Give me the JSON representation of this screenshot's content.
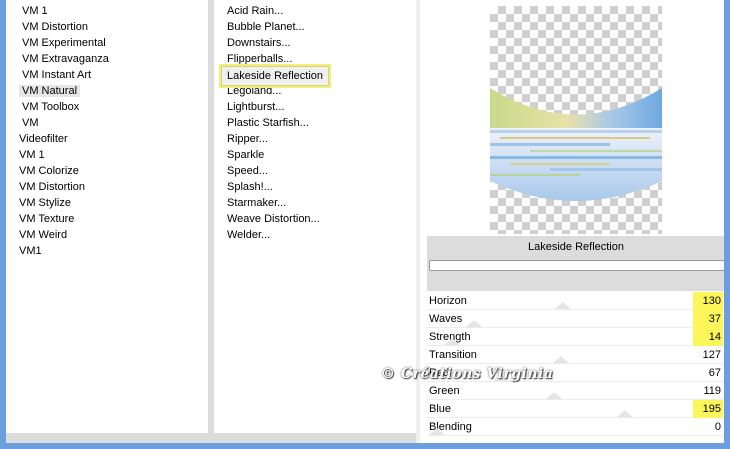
{
  "categories": {
    "items": [
      {
        "label": "VM 1",
        "indent": true
      },
      {
        "label": "VM Distortion",
        "indent": true
      },
      {
        "label": "VM Experimental",
        "indent": true
      },
      {
        "label": "VM Extravaganza",
        "indent": true
      },
      {
        "label": "VM Instant Art",
        "indent": true
      },
      {
        "label": "VM Natural",
        "indent": true,
        "selected": true
      },
      {
        "label": "VM Toolbox",
        "indent": true
      },
      {
        "label": "VM",
        "indent": true
      },
      {
        "label": "Videofilter",
        "indent": false
      },
      {
        "label": "VM 1",
        "indent": false
      },
      {
        "label": "VM Colorize",
        "indent": false
      },
      {
        "label": "VM Distortion",
        "indent": false
      },
      {
        "label": "VM Stylize",
        "indent": false
      },
      {
        "label": "VM Texture",
        "indent": false
      },
      {
        "label": "VM Weird",
        "indent": false
      },
      {
        "label": "VM1",
        "indent": false
      }
    ]
  },
  "filters": {
    "items": [
      {
        "label": "Acid Rain..."
      },
      {
        "label": "Bubble Planet..."
      },
      {
        "label": "Downstairs..."
      },
      {
        "label": "Flipperballs..."
      },
      {
        "label": "Lakeside Reflection",
        "selected": true
      },
      {
        "label": "Legoland..."
      },
      {
        "label": "Lightburst..."
      },
      {
        "label": "Plastic Starfish..."
      },
      {
        "label": "Ripper..."
      },
      {
        "label": "Sparkle"
      },
      {
        "label": "Speed..."
      },
      {
        "label": "Splash!..."
      },
      {
        "label": "Starmaker..."
      },
      {
        "label": "Weave Distortion..."
      },
      {
        "label": "Welder..."
      }
    ]
  },
  "preview": {
    "title": "Lakeside Reflection",
    "progress": 0
  },
  "params": [
    {
      "label": "Horizon",
      "value": "130",
      "highlight": true,
      "fraction": 0.51
    },
    {
      "label": "Waves",
      "value": "37",
      "highlight": true,
      "fraction": 0.15
    },
    {
      "label": "Strength",
      "value": "14",
      "highlight": true,
      "fraction": 0.06
    },
    {
      "label": "Transition",
      "value": "127",
      "highlight": false,
      "fraction": 0.5
    },
    {
      "label": "Red",
      "value": "67",
      "highlight": false,
      "fraction": 0.26
    },
    {
      "label": "Green",
      "value": "119",
      "highlight": false,
      "fraction": 0.47
    },
    {
      "label": "Blue",
      "value": "195",
      "highlight": true,
      "fraction": 0.76
    },
    {
      "label": "Blending",
      "value": "0",
      "highlight": false,
      "fraction": 0.0
    }
  ],
  "watermark": "© Créations Virginia",
  "colors": {
    "background": "#6a9edd",
    "highlight": "#fbf75b",
    "selection_border": "#f2ee7a"
  }
}
